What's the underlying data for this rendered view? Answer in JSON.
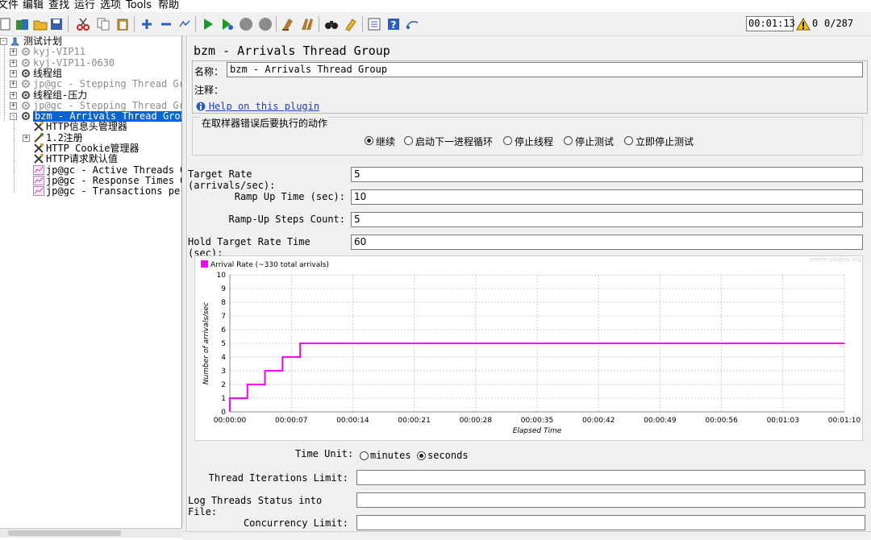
{
  "menubar": [
    "文件",
    "编辑",
    "查找",
    "运行",
    "选项",
    "Tools",
    "帮助"
  ],
  "toolbar": {
    "timer": "00:01:13",
    "warnings": "0",
    "threads": "0/287",
    "icons": [
      "new-icon",
      "templates-icon",
      "open-icon",
      "save-icon",
      "cut-icon",
      "copy-icon",
      "paste-icon",
      "add-icon",
      "remove-icon",
      "toggle-icon",
      "start-icon",
      "start-no-pause-icon",
      "stop-icon",
      "shutdown-icon",
      "clear-icon",
      "clear-all-icon",
      "search-icon",
      "reset-search-icon",
      "function-helper-icon",
      "help-icon",
      "remote-icon"
    ]
  },
  "tree": {
    "root": "测试计划",
    "items": [
      {
        "label": "kyj-VIP11",
        "disabled": true,
        "level": 1,
        "expander": "+"
      },
      {
        "label": "kyj-VIP11-0630",
        "disabled": true,
        "level": 1,
        "expander": "+"
      },
      {
        "label": "线程组",
        "disabled": false,
        "level": 1,
        "expander": "+"
      },
      {
        "label": "jp@gc - Stepping Thread Group",
        "disabled": true,
        "level": 1,
        "expander": "+"
      },
      {
        "label": "线程组-压力",
        "disabled": false,
        "level": 1,
        "expander": "+"
      },
      {
        "label": "jp@gc - Stepping Thread Group",
        "disabled": true,
        "level": 1,
        "expander": "+"
      },
      {
        "label": "bzm - Arrivals Thread Group",
        "disabled": false,
        "level": 1,
        "expander": "-",
        "selected": true
      },
      {
        "label": "HTTP信息头管理器",
        "disabled": false,
        "level": 2
      },
      {
        "label": "1.2注册",
        "disabled": false,
        "level": 2,
        "expander": "+"
      },
      {
        "label": "HTTP Cookie管理器",
        "disabled": false,
        "level": 2
      },
      {
        "label": "HTTP请求默认值",
        "disabled": false,
        "level": 2
      },
      {
        "label": "jp@gc - Active Threads Over Time",
        "disabled": false,
        "level": 2
      },
      {
        "label": "jp@gc - Response Times Over Time",
        "disabled": false,
        "level": 2
      },
      {
        "label": "jp@gc - Transactions per Second",
        "disabled": false,
        "level": 2
      }
    ]
  },
  "panel": {
    "title": "bzm - Arrivals Thread Group",
    "name_label": "名称：",
    "name_value": "bzm - Arrivals Thread Group",
    "comment_label": "注释：",
    "help_link": "Help on this plugin",
    "error_action_title": "在取样器错误后要执行的动作",
    "error_actions": [
      {
        "label": "继续",
        "selected": true
      },
      {
        "label": "启动下一进程循环",
        "selected": false
      },
      {
        "label": "停止线程",
        "selected": false
      },
      {
        "label": "停止测试",
        "selected": false
      },
      {
        "label": "立即停止测试",
        "selected": false
      }
    ],
    "params": [
      {
        "label": "Target Rate (arrivals/sec):",
        "value": "5"
      },
      {
        "label": "Ramp Up Time (sec):",
        "value": "10"
      },
      {
        "label": "Ramp-Up Steps Count:",
        "value": "5"
      },
      {
        "label": "Hold Target Rate Time (sec):",
        "value": "60"
      }
    ],
    "time_unit_label": "Time Unit:",
    "time_unit_options": [
      {
        "label": "minutes",
        "selected": false
      },
      {
        "label": "seconds",
        "selected": true
      }
    ],
    "extra_fields": [
      {
        "label": "Thread Iterations Limit:",
        "value": ""
      },
      {
        "label": "Log Threads Status into File:",
        "value": ""
      },
      {
        "label": "Concurrency Limit:",
        "value": ""
      }
    ]
  },
  "chart_data": {
    "type": "line",
    "watermark": "jmeter-plugins.org",
    "series": [
      {
        "name": "Arrival Rate (~330 total arrivals)",
        "color": "#ff00ff",
        "x": [
          0,
          0,
          2,
          2,
          4,
          4,
          6,
          6,
          8,
          8,
          70
        ],
        "values": [
          0,
          1,
          1,
          2,
          2,
          3,
          3,
          4,
          4,
          5,
          5
        ]
      }
    ],
    "xlabel": "Elapsed Time",
    "ylabel": "Number of arrivals/sec",
    "xlim": [
      0,
      70
    ],
    "ylim": [
      0,
      10
    ],
    "x_ticks": [
      "00:00:00",
      "00:00:07",
      "00:00:14",
      "00:00:21",
      "00:00:28",
      "00:00:35",
      "00:00:42",
      "00:00:49",
      "00:00:56",
      "00:01:03",
      "00:01:10"
    ],
    "y_ticks": [
      "0",
      "1",
      "2",
      "3",
      "4",
      "5",
      "6",
      "7",
      "8",
      "9",
      "10"
    ],
    "grid": true,
    "legend_placement": "top-left"
  }
}
